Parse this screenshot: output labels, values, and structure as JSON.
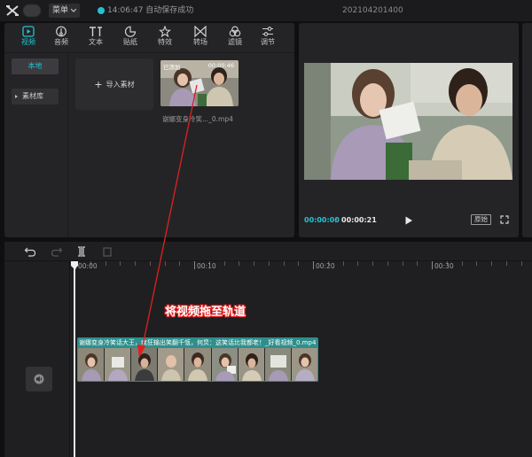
{
  "titlebar": {
    "menu_label": "菜单",
    "save_time": "14:06:47",
    "save_text": "自动保存成功",
    "project_name": "202104201400"
  },
  "toolbar": {
    "items": [
      {
        "label": "视频",
        "icon": "video-icon",
        "active": true
      },
      {
        "label": "音频",
        "icon": "audio-icon",
        "active": false
      },
      {
        "label": "文本",
        "icon": "text-icon",
        "active": false
      },
      {
        "label": "贴纸",
        "icon": "sticker-icon",
        "active": false
      },
      {
        "label": "特效",
        "icon": "effects-icon",
        "active": false
      },
      {
        "label": "转场",
        "icon": "transition-icon",
        "active": false
      },
      {
        "label": "滤镜",
        "icon": "filter-icon",
        "active": false
      },
      {
        "label": "调节",
        "icon": "adjust-icon",
        "active": false
      }
    ]
  },
  "sidebar": {
    "local_label": "本地",
    "library_label": "素材库"
  },
  "media": {
    "import_label": "导入素材",
    "thumb_badge": "已添加",
    "thumb_duration": "00:00:46",
    "filename": "谢娜变身冷笑..._0.mp4"
  },
  "player": {
    "current_time": "00:00:00",
    "separator": "/",
    "total_time": "00:00:21",
    "ratio_label": "原始"
  },
  "timeline": {
    "ruler_labels": [
      "00:00",
      "00:10",
      "00:20",
      "00:30"
    ],
    "clip_label": "谢娜变身冷笑话大王，疯狂输出笑翻千瓴，何炅：这笑话比我都老！_好看视频_0.mp4"
  },
  "annotation": {
    "text": "将视频拖至轨道",
    "color": "#e02020"
  },
  "colors": {
    "accent": "#22c3cf",
    "clip": "#2f8f8c",
    "panel": "#242427",
    "background": "#0f0f10"
  }
}
